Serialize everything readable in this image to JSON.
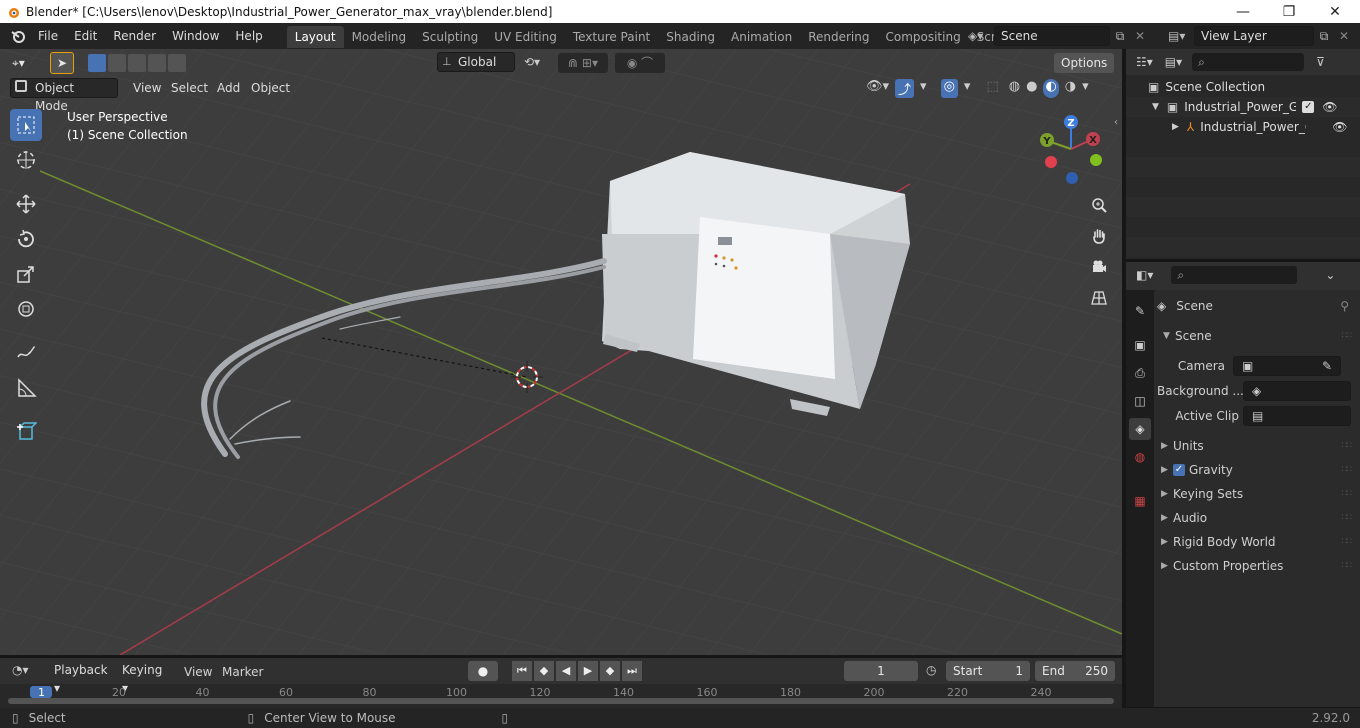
{
  "window": {
    "title": "Blender* [C:\\Users\\lenov\\Desktop\\Industrial_Power_Generator_max_vray\\blender.blend]",
    "minimize": "—",
    "maximize": "❐",
    "close": "✕"
  },
  "menubar": {
    "items": [
      "File",
      "Edit",
      "Render",
      "Window",
      "Help"
    ]
  },
  "workspaces": {
    "tabs": [
      "Layout",
      "Modeling",
      "Sculpting",
      "UV Editing",
      "Texture Paint",
      "Shading",
      "Animation",
      "Rendering",
      "Compositing",
      "Scripting"
    ],
    "active": "Layout",
    "add": "+"
  },
  "scene_selector": {
    "value": "Scene"
  },
  "viewlayer_selector": {
    "value": "View Layer"
  },
  "header3d": {
    "transform_orientation": "Global",
    "options": "Options",
    "mode": "Object Mode",
    "menus": [
      "View",
      "Select",
      "Add",
      "Object"
    ]
  },
  "viewport": {
    "perspective": "User Perspective",
    "collection": "(1) Scene Collection",
    "gizmo": {
      "z": "Z",
      "y": "Y",
      "x": "X"
    }
  },
  "outliner": {
    "root": "Scene Collection",
    "items": [
      {
        "label": "Industrial_Power_Genera",
        "level": 1,
        "expanded": true,
        "checked": true
      },
      {
        "label": "Industrial_Power_Ge",
        "level": 2,
        "expanded": false
      }
    ]
  },
  "properties": {
    "context": "Scene",
    "panel_title": "Scene",
    "fields": [
      {
        "label": "Camera",
        "value": ""
      },
      {
        "label": "Background ...",
        "value": ""
      },
      {
        "label": "Active Clip",
        "value": ""
      }
    ],
    "panels": [
      {
        "label": "Units",
        "checkbox": false
      },
      {
        "label": "Gravity",
        "checkbox": true
      },
      {
        "label": "Keying Sets",
        "checkbox": false
      },
      {
        "label": "Audio",
        "checkbox": false
      },
      {
        "label": "Rigid Body World",
        "checkbox": false
      },
      {
        "label": "Custom Properties",
        "checkbox": false
      }
    ]
  },
  "timeline": {
    "menus": [
      "Playback",
      "Keying",
      "View",
      "Marker"
    ],
    "current_frame": "1",
    "start_label": "Start",
    "start": "1",
    "end_label": "End",
    "end": "250",
    "ruler": [
      "1",
      "20",
      "40",
      "60",
      "80",
      "100",
      "120",
      "140",
      "160",
      "180",
      "200",
      "220",
      "240"
    ]
  },
  "statusbar": {
    "select": "Select",
    "center_view": "Center View to Mouse",
    "version": "2.92.0"
  },
  "colors": {
    "accent": "#4772b3",
    "x_axis": "#c04050",
    "y_axis": "#7da02a",
    "z_axis": "#3c7ee0"
  }
}
